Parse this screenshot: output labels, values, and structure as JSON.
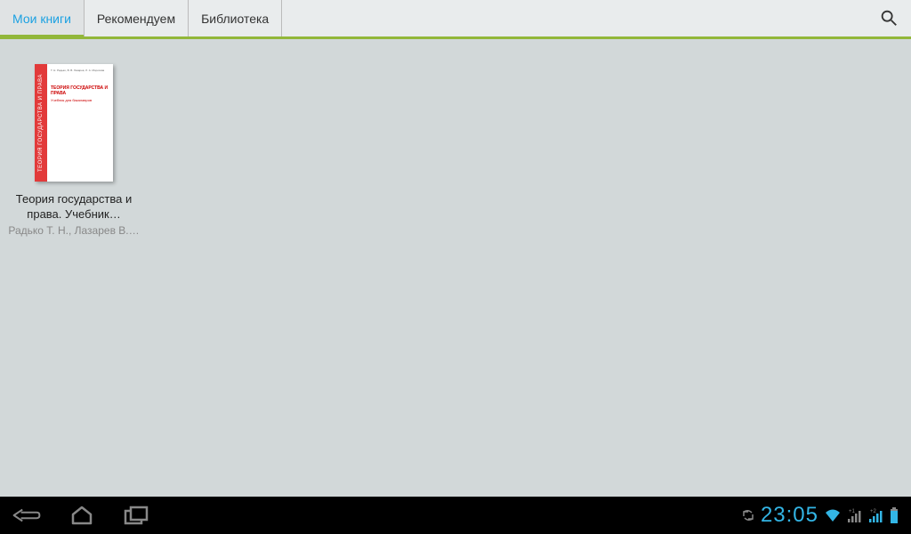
{
  "tabs": {
    "my_books": "Мои книги",
    "recommended": "Рекомендуем",
    "library": "Библиотека"
  },
  "books": [
    {
      "title": "Теория государства и права. Учебник…",
      "author": "Радько Т. Н., Лазарев В.…",
      "spine_text": "ТЕОРИЯ ГОСУДАРСТВА И ПРАВА",
      "cover_authors": "Т. Н. Радько, В. В. Лазарев, Л. А. Морозова",
      "cover_title": "ТЕОРИЯ ГОСУДАРСТВА И ПРАВА",
      "cover_subtitle": "Учебник для бакалавров"
    }
  ],
  "status": {
    "time": "23:05"
  },
  "colors": {
    "accent_blue": "#1ba1e2",
    "accent_green": "#92b73a",
    "status_blue": "#33b5e5"
  }
}
